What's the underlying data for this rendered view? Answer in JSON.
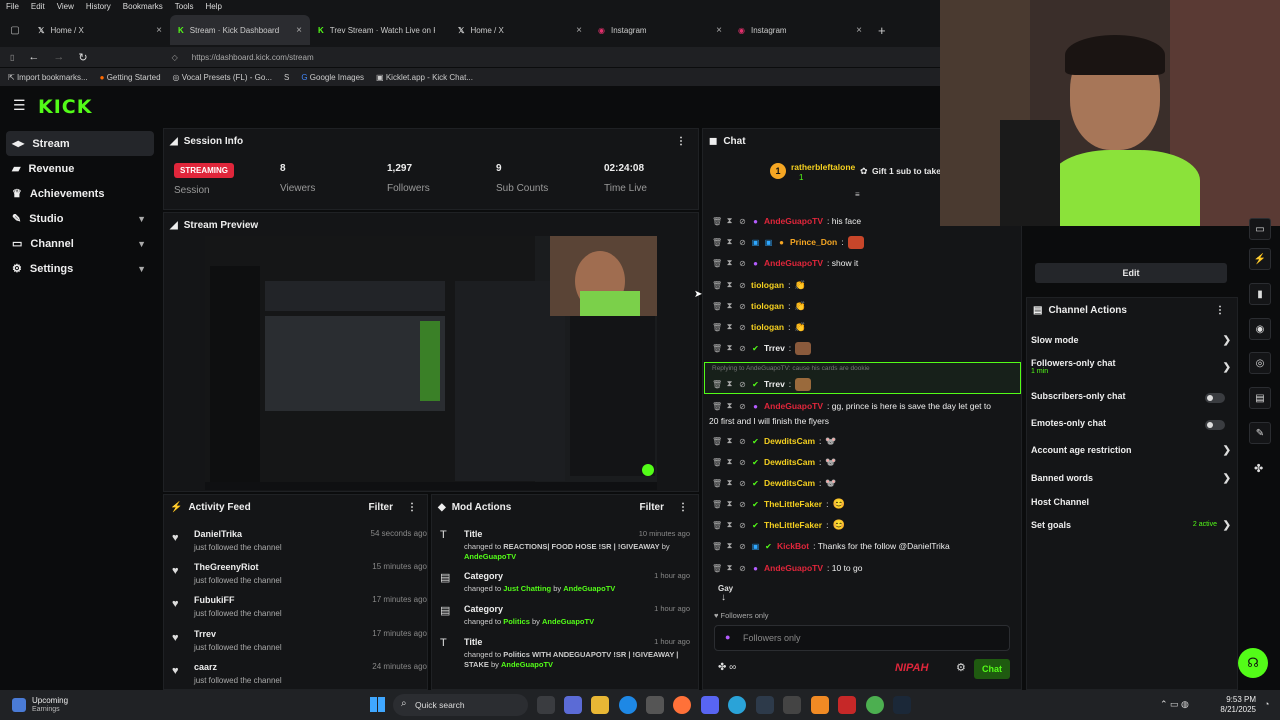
{
  "browser": {
    "menu": [
      "File",
      "Edit",
      "View",
      "History",
      "Bookmarks",
      "Tools",
      "Help"
    ],
    "tabs": [
      {
        "label": "Home / X",
        "icon": "x-icon"
      },
      {
        "label": "Stream · Kick Dashboard",
        "icon": "kick-icon"
      },
      {
        "label": "Trev Stream · Watch Live on Ki",
        "icon": "kick-icon"
      },
      {
        "label": "Home / X",
        "icon": "x-icon"
      },
      {
        "label": "Instagram",
        "icon": "instagram-icon"
      },
      {
        "label": "Instagram",
        "icon": "instagram-icon"
      }
    ],
    "url": "https://dashboard.kick.com/stream",
    "bookmarks": [
      "Import bookmarks...",
      "Getting Started",
      "Vocal Presets (FL) - Go...",
      "Google Images",
      "Kicklet.app - Kick Chat..."
    ]
  },
  "logo": "KICK",
  "sidebar": {
    "items": [
      {
        "label": "Stream",
        "active": true,
        "icon": "stream-icon"
      },
      {
        "label": "Revenue",
        "icon": "revenue-icon"
      },
      {
        "label": "Achievements",
        "icon": "trophy-icon"
      },
      {
        "label": "Studio",
        "icon": "studio-icon",
        "expandable": true
      },
      {
        "label": "Channel",
        "icon": "channel-icon",
        "expandable": true
      },
      {
        "label": "Settings",
        "icon": "gear-icon",
        "expandable": true
      }
    ]
  },
  "session": {
    "title": "Session Info",
    "status": "STREAMING",
    "status_label": "Session",
    "viewers": "8",
    "viewers_label": "Viewers",
    "followers": "1,297",
    "followers_label": "Followers",
    "subs": "9",
    "subs_label": "Sub Counts",
    "time": "02:24:08",
    "time_label": "Time Live"
  },
  "preview": {
    "title": "Stream Preview"
  },
  "activity": {
    "title": "Activity Feed",
    "filter": "Filter",
    "items": [
      {
        "name": "DanielTrika",
        "sub": "just followed the channel",
        "time": "54 seconds ago"
      },
      {
        "name": "TheGreenyRiot",
        "sub": "just followed the channel",
        "time": "15 minutes ago"
      },
      {
        "name": "FubukiFF",
        "sub": "just followed the channel",
        "time": "17 minutes ago"
      },
      {
        "name": "Trrev",
        "sub": "just followed the channel",
        "time": "17 minutes ago"
      },
      {
        "name": "caarz",
        "sub": "just followed the channel",
        "time": "24 minutes ago"
      }
    ]
  },
  "mod": {
    "title": "Mod Actions",
    "filter": "Filter",
    "items": [
      {
        "name": "Title",
        "pre": "changed to ",
        "value": "REACTIONS| FOOD HOSE !SR | !GIVEAWAY",
        "by": " by ",
        "user": "AndeGuapoTV",
        "time": "10 minutes ago"
      },
      {
        "name": "Category",
        "pre": "changed to ",
        "value": "Just Chatting",
        "by": " by ",
        "user": "AndeGuapoTV",
        "time": "1 hour ago"
      },
      {
        "name": "Category",
        "pre": "changed to ",
        "value": "Politics",
        "by": " by ",
        "user": "AndeGuapoTV",
        "time": "1 hour ago"
      },
      {
        "name": "Title",
        "pre": "changed to ",
        "value": "Politics WITH ANDEGUAPOTV !SR | !GIVEAWAY | STAKE",
        "by": " by ",
        "user": "AndeGuapoTV",
        "time": "1 hour ago"
      }
    ]
  },
  "chat": {
    "title": "Chat",
    "pinned_user": "ratherbleftalone",
    "pinned_count": "1",
    "gift": "Gift 1 sub to take",
    "reply_note": "Replying to AndeGuapoTV: cause his cards are dookie",
    "messages": [
      {
        "user": "AndeGuapoTV",
        "text": ": his face",
        "color": "#e0263b"
      },
      {
        "user": "Prince_Don",
        "text": ":",
        "color": "#f5a623"
      },
      {
        "user": "AndeGuapoTV",
        "text": ": show it",
        "color": "#e0263b"
      },
      {
        "user": "tiologan",
        "text": ":",
        "color": "#f5d020"
      },
      {
        "user": "tiologan",
        "text": ":",
        "color": "#f5d020"
      },
      {
        "user": "tiologan",
        "text": ":",
        "color": "#f5d020"
      },
      {
        "user": "Trrev",
        "text": ":",
        "color": "#eeeeee"
      },
      {
        "user": "Trrev",
        "text": ":",
        "color": "#eeeeee"
      },
      {
        "user": "AndeGuapoTV",
        "text": ": gg, prince is here is save the day let get to",
        "color": "#e0263b"
      },
      {
        "user": "",
        "text": "20 first and I will finish the flyers",
        "color": "#eeeeee"
      },
      {
        "user": "DewditsCam",
        "text": ":",
        "color": "#f5d020"
      },
      {
        "user": "DewditsCam",
        "text": ":",
        "color": "#f5d020"
      },
      {
        "user": "DewditsCam",
        "text": ":",
        "color": "#f5d020"
      },
      {
        "user": "TheLittleFaker",
        "text": ":",
        "color": "#f5d020"
      },
      {
        "user": "TheLittleFaker",
        "text": ":",
        "color": "#f5d020"
      },
      {
        "user": "KickBot",
        "text": ": Thanks for the follow @DanielTrika",
        "color": "#e0263b"
      },
      {
        "user": "AndeGuapoTV",
        "text": ": 10 to go",
        "color": "#e0263b"
      }
    ],
    "emote_label": "Gay",
    "mode_note": "Followers only",
    "input_placeholder": "Followers only",
    "brand": "NIPAH",
    "send": "Chat"
  },
  "actions": {
    "edit": "Edit",
    "title": "Channel Actions",
    "rows": [
      {
        "label": "Slow mode",
        "type": "chevron"
      },
      {
        "label": "Followers-only chat",
        "sub": "1 min",
        "type": "chevron"
      },
      {
        "label": "Subscribers-only chat",
        "type": "toggle"
      },
      {
        "label": "Emotes-only chat",
        "type": "toggle"
      },
      {
        "label": "Account age restriction",
        "type": "chevron"
      },
      {
        "label": "Banned words",
        "type": "chevron"
      },
      {
        "label": "Host Channel",
        "type": "none"
      },
      {
        "label": "Set goals",
        "sub": "2 active",
        "type": "chevron"
      }
    ]
  },
  "taskbar": {
    "weather_title": "Upcoming",
    "weather_sub": "Earnings",
    "search": "Quick search",
    "time": "9:53 PM",
    "date": "8/21/2025"
  },
  "colors": {
    "accent": "#53fc18",
    "live": "#e0263b",
    "bg": "#0b0c0d",
    "panel": "#141517"
  }
}
